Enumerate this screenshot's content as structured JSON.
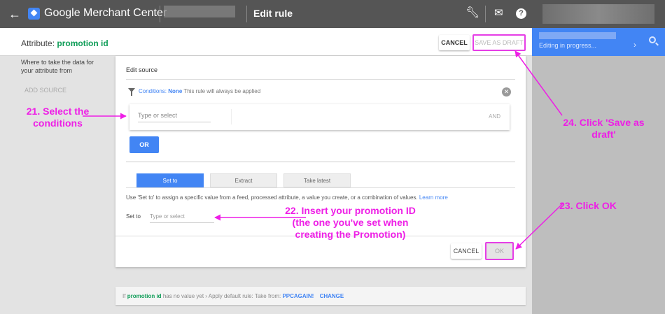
{
  "topbar": {
    "app_name": "Google Merchant Center",
    "page_title": "Edit rule"
  },
  "header": {
    "attribute_prefix": "Attribute:",
    "attribute_name": "promotion id",
    "cancel_label": "CANCEL",
    "save_draft_label": "SAVE AS DRAFT"
  },
  "right_panel": {
    "status": "Editing in progress..."
  },
  "left": {
    "description": "Where to take the data for your attribute from",
    "add_source": "ADD SOURCE"
  },
  "editor": {
    "edit_source_title": "Edit source",
    "conditions_label": "Conditions:",
    "conditions_value": "None",
    "conditions_note": "This rule will always be applied",
    "condition_placeholder": "Type or select",
    "and_label": "AND",
    "or_label": "OR",
    "tabs": [
      "Set to",
      "Extract",
      "Take latest"
    ],
    "help_text": "Use 'Set to' to assign a specific value from a feed, processed attribute, a value you create, or a combination of values.",
    "learn_more": "Learn more",
    "set_to_label": "Set to",
    "set_to_placeholder": "Type or select",
    "cancel_label": "CANCEL",
    "ok_label": "OK"
  },
  "default_rule": {
    "prefix": "If",
    "attribute": "promotion id",
    "middle": "has no value yet › Apply default rule: Take from:",
    "source": "PPCAGAIN!",
    "change": "CHANGE"
  },
  "annotations": {
    "step21": "21. Select the conditions",
    "step22": "22. Insert your promotion ID (the one you've set when creating the Promotion)",
    "step23": "23. Click OK",
    "step24": "24. Click 'Save as draft'"
  },
  "colors": {
    "annotation": "#ee1ee6",
    "accent": "#4285f4",
    "attribute_green": "#0f9d58"
  }
}
